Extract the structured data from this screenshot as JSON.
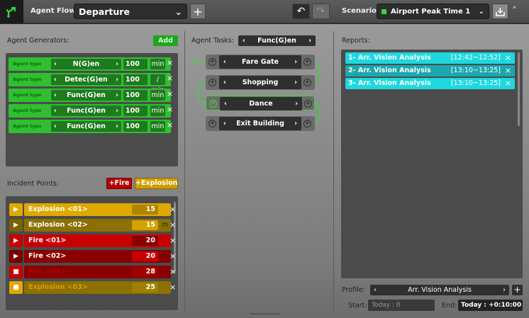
{
  "header": {
    "agent_flow_label": "Agent Flow:",
    "agent_flow_value": "Departure",
    "scenario_label": "Scenario:",
    "scenario_value": "Airport Peak Time 1"
  },
  "generators": {
    "title": "Agent Generators:",
    "add_label": "Add",
    "rows": [
      {
        "type_label": "Agent type",
        "name": "N(G)en",
        "value": "100",
        "unit": "min"
      },
      {
        "type_label": "Agent type",
        "name": "Detec(G)en",
        "value": "100",
        "unit": "/ min"
      },
      {
        "type_label": "Agent type",
        "name": "Func(G)en",
        "value": "100",
        "unit": "min"
      },
      {
        "type_label": "Agent type",
        "name": "Func(G)en",
        "value": "100",
        "unit": "min"
      },
      {
        "type_label": "Agent type",
        "name": "Func(G)en",
        "value": "100",
        "unit": "min"
      }
    ]
  },
  "incidents": {
    "title": "Incident Points:",
    "add_fire": "+Fire",
    "add_explosion": "+Explosion",
    "rows": [
      {
        "name": "Explosion <01>",
        "value": "15",
        "unit": "m"
      },
      {
        "name": "Explosion <02>",
        "value": "15",
        "unit": "m"
      },
      {
        "name": "Fire <01>",
        "value": "20",
        "unit": "m"
      },
      {
        "name": "Fire <02>",
        "value": "20",
        "unit": "m"
      },
      {
        "name": "Fire <03>",
        "value": "28",
        "unit": "m"
      },
      {
        "name": "Explosion <03>",
        "value": "25",
        "unit": "m"
      }
    ]
  },
  "tasks": {
    "title": "Agent Tasks:",
    "generator_value": "Func(G)en",
    "items": [
      {
        "label": "Fare Gate"
      },
      {
        "label": "Shopping"
      },
      {
        "label": "Dance"
      },
      {
        "label": "Exit Building"
      }
    ]
  },
  "reports": {
    "title": "Reports:",
    "items": [
      {
        "name": "1- Arr. Vision Analysis",
        "time": "[12:42~12:52]"
      },
      {
        "name": "2- Arr. Vision Analysis",
        "time": "[13:10~13:25]"
      },
      {
        "name": "3- Arr. Vision Analysis",
        "time": "[13:10~13:25]"
      }
    ],
    "profile_label": "Profile:",
    "profile_value": "Arr. Vision Analysis",
    "start_label": "Start:",
    "start_value": "Today : 0",
    "end_label": "End:",
    "end_value": "Today : +0:10:00"
  },
  "colors": {
    "green": "#2fbf2f",
    "cyan": "#1ed8e0",
    "fire": "#c80000",
    "explosion": "#e0a800"
  },
  "icons": {
    "logo": "branch-logo-icon",
    "undo": "undo-icon",
    "redo": "redo-icon",
    "save": "save-icon",
    "collapse": "chevron-up-icon"
  }
}
